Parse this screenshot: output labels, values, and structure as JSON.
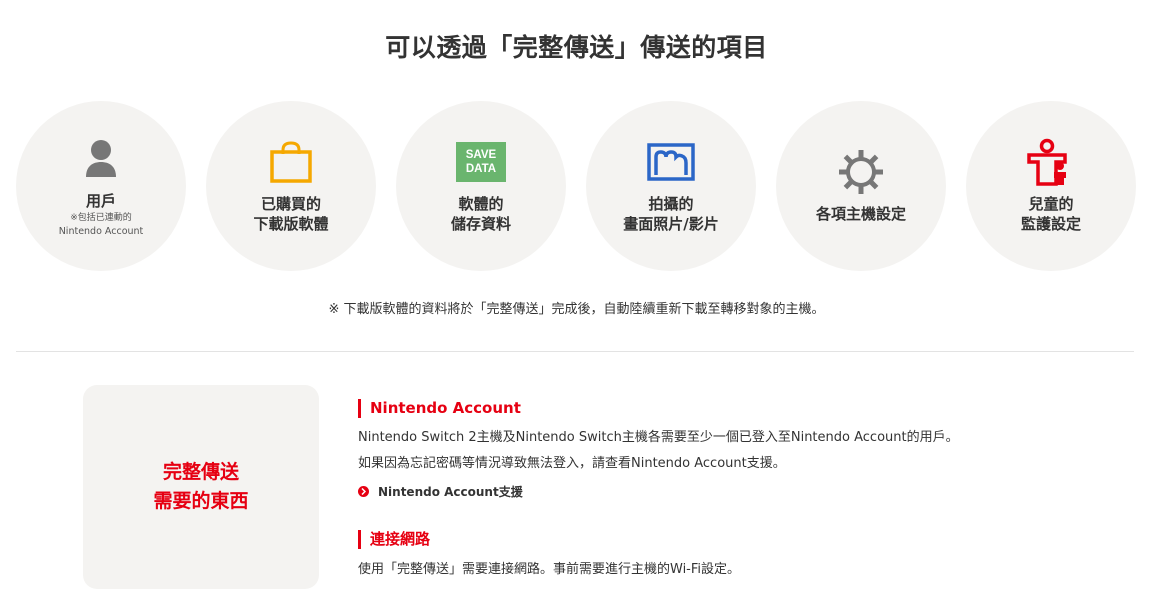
{
  "title": "可以透過「完整傳送」傳送的項目",
  "items": [
    {
      "label_1": "用戶",
      "note_1": "※包括已連動的",
      "note_2": "Nintendo Account",
      "icon": "user-icon"
    },
    {
      "label_1": "已購買的",
      "label_2": "下載版軟體",
      "icon": "shopping-bag-icon"
    },
    {
      "label_1": "軟體的",
      "label_2": "儲存資料",
      "icon": "save-data-icon",
      "icon_text_1": "SAVE",
      "icon_text_2": "DATA"
    },
    {
      "label_1": "拍攝的",
      "label_2": "畫面照片/影片",
      "icon": "album-icon"
    },
    {
      "label_1": "各項主機設定",
      "icon": "gear-icon"
    },
    {
      "label_1": "兒童的",
      "label_2": "監護設定",
      "icon": "parental-controls-icon"
    }
  ],
  "footnote": "※ 下載版軟體的資料將於「完整傳送」完成後，自動陸續重新下載至轉移對象的主機。",
  "requirements": {
    "box_line_1": "完整傳送",
    "box_line_2": "需要的東西",
    "sections": [
      {
        "heading": "Nintendo Account",
        "lines": [
          "Nintendo Switch 2主機及Nintendo Switch主機各需要至少一個已登入至Nintendo Account的用戶。",
          "如果因為忘記密碼等情況導致無法登入，請查看Nintendo Account支援。"
        ],
        "link": "Nintendo Account支援"
      },
      {
        "heading": "連接網路",
        "lines": [
          "使用「完整傳送」需要連接網路。事前需要進行主機的Wi-Fi設定。"
        ]
      }
    ]
  },
  "colors": {
    "accent": "#e60012",
    "circle_bg": "#f4f3f1",
    "icon_gray": "#777777",
    "bag": "#f5a800",
    "save": "#6ab56e",
    "album": "#2b66c7"
  }
}
